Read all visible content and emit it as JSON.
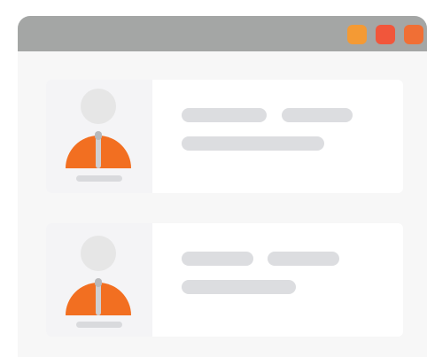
{
  "window": {
    "buttons": [
      {
        "icon": "window-button-minimize-icon",
        "color": "#f49a34"
      },
      {
        "icon": "window-button-maximize-icon",
        "color": "#f1563b"
      },
      {
        "icon": "window-button-close-icon",
        "color": "#f06f35"
      }
    ]
  },
  "cards": [
    {
      "avatar_icon": "user-avatar-icon",
      "accent_color": "#f26f21"
    },
    {
      "avatar_icon": "user-avatar-icon",
      "accent_color": "#f26f21"
    }
  ],
  "colors": {
    "titlebar": "#a4a6a5",
    "window_bg": "#f7f7f7",
    "card_bg": "#ffffff",
    "placeholder_line": "#dcdde0",
    "avatar_head": "#e6e6e6",
    "avatar_body": "#f26f21"
  }
}
